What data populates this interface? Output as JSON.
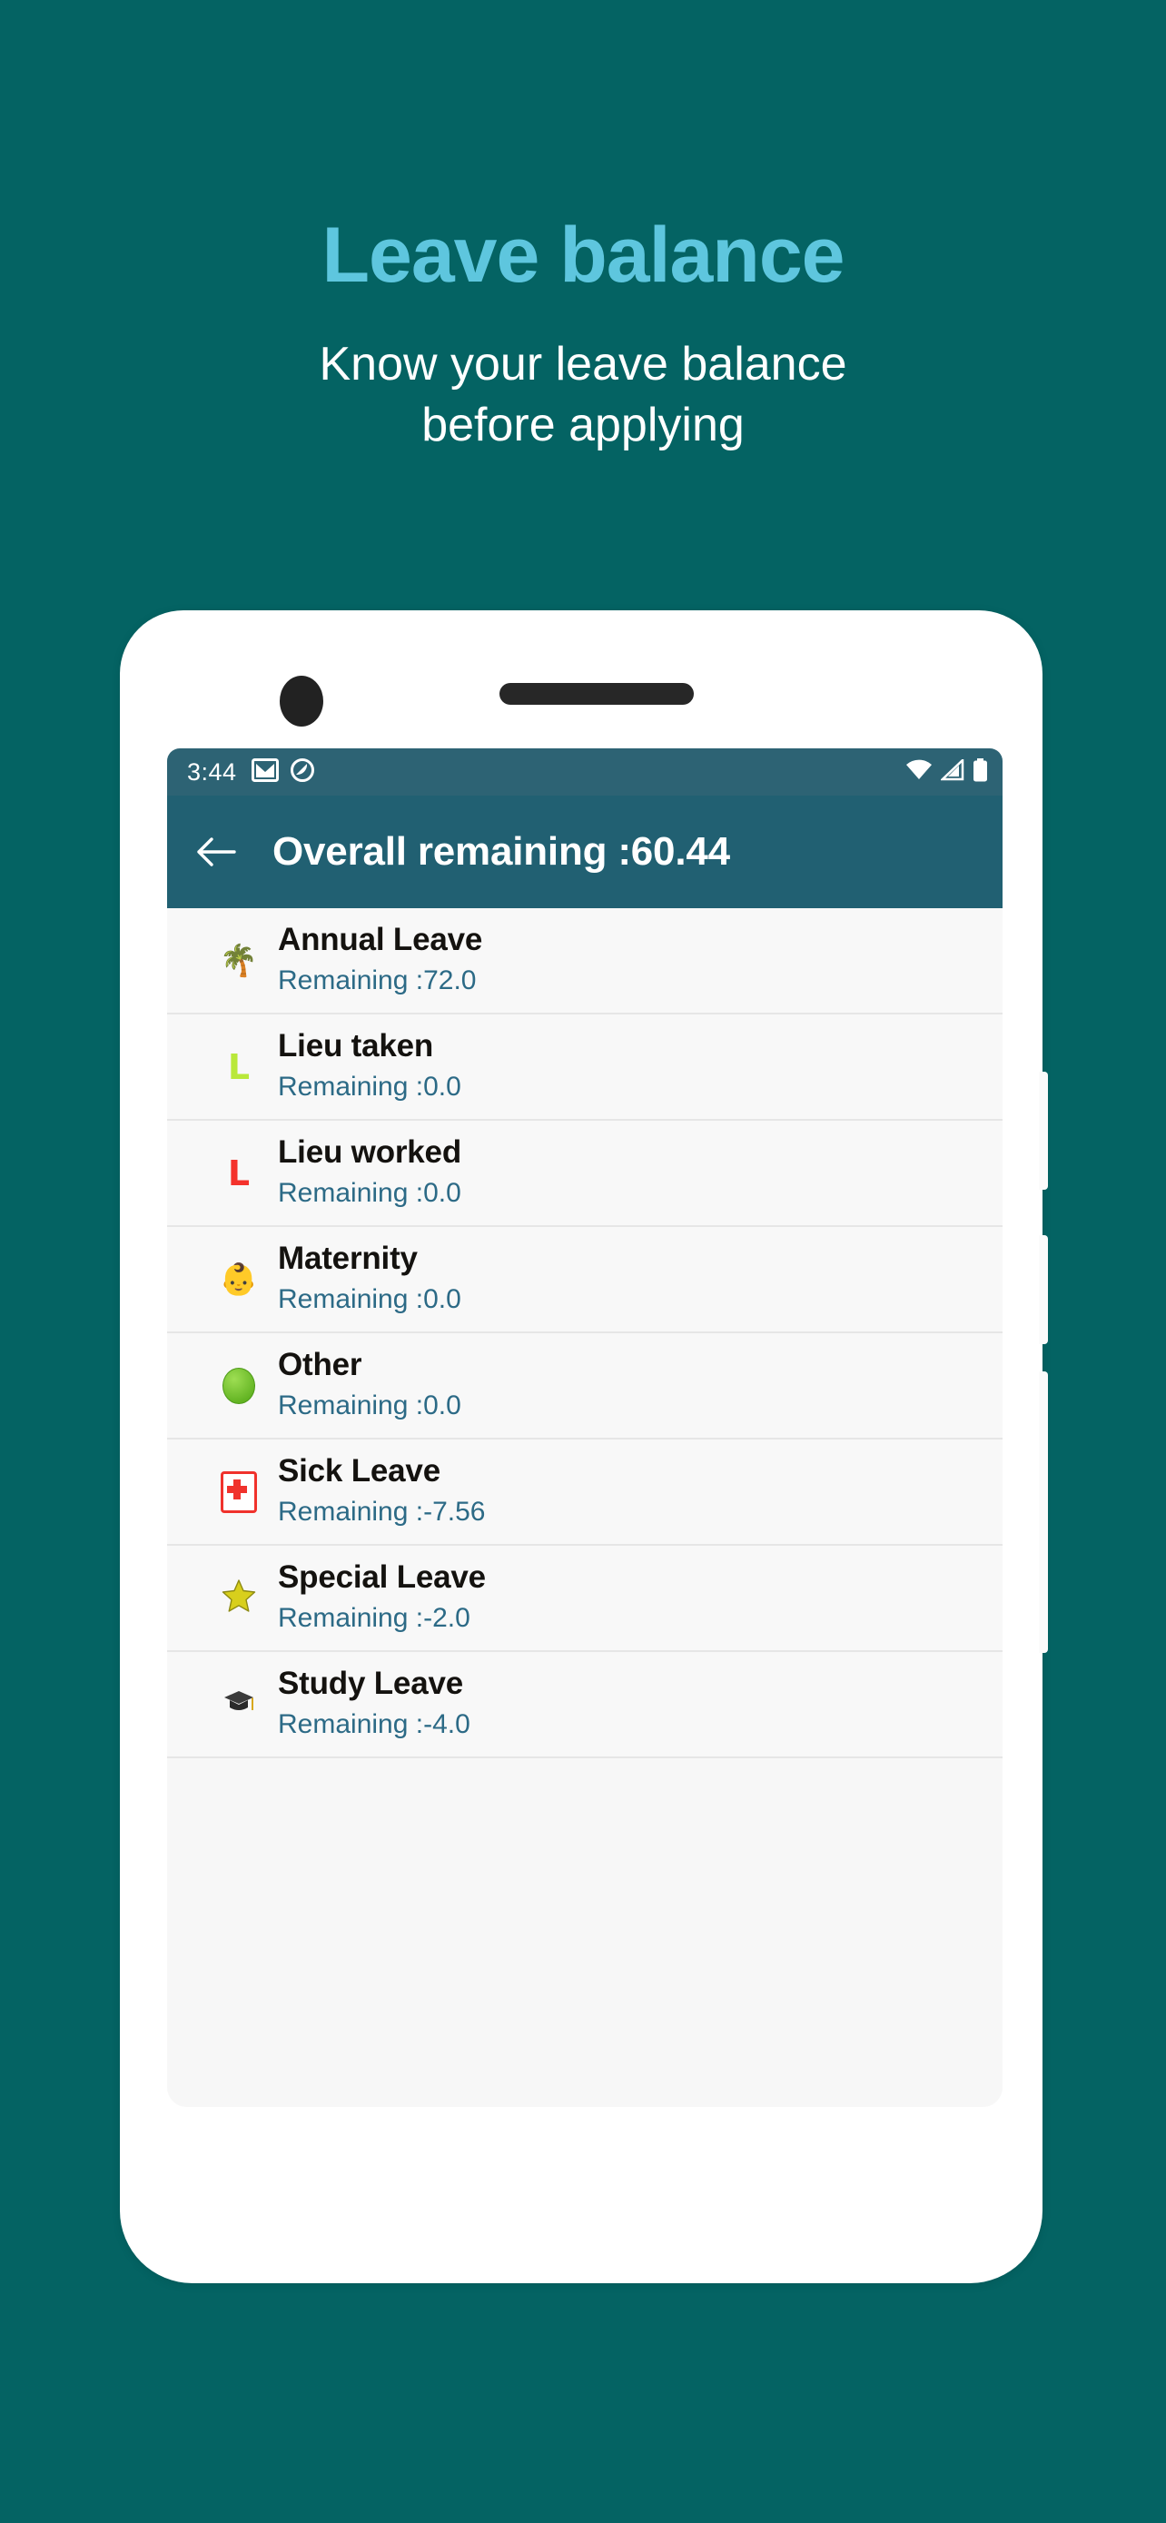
{
  "promo": {
    "title": "Leave balance",
    "subtitle_line1": "Know your leave balance",
    "subtitle_line2": "before applying",
    "title_color": "#5ec6de",
    "background_color": "#046363",
    "subtitle_color": "#ffffff"
  },
  "phone": {
    "statusbar": {
      "time": "3:44",
      "left_icons": [
        "gmail-icon",
        "do-not-disturb-icon"
      ],
      "right_icons": [
        "wifi-icon",
        "cellular-signal-icon",
        "battery-icon"
      ],
      "background_color": "#2d6374"
    },
    "appbar": {
      "back_label": "←",
      "title": "Overall remaining :60.44",
      "background_color": "#216072"
    },
    "list": [
      {
        "icon": "palm-tree-emoji",
        "glyph": "🌴",
        "title": "Annual Leave",
        "remaining": "Remaining :72.0"
      },
      {
        "icon": "letter-l-green-icon",
        "glyph": "L",
        "title": "Lieu taken",
        "remaining": "Remaining :0.0"
      },
      {
        "icon": "letter-l-red-icon",
        "glyph": "L",
        "title": "Lieu worked",
        "remaining": "Remaining :0.0"
      },
      {
        "icon": "baby-carriage-emoji",
        "glyph": "👶",
        "title": "Maternity",
        "remaining": "Remaining :0.0"
      },
      {
        "icon": "green-circle-icon",
        "glyph": "",
        "title": "Other",
        "remaining": "Remaining :0.0"
      },
      {
        "icon": "red-cross-icon",
        "glyph": "",
        "title": "Sick Leave",
        "remaining": "Remaining :-7.56"
      },
      {
        "icon": "star-emoji",
        "glyph": "⭐",
        "title": "Special Leave",
        "remaining": "Remaining :-2.0"
      },
      {
        "icon": "graduation-cap-emoji",
        "glyph": "🎓",
        "title": "Study Leave",
        "remaining": "Remaining :-4.0"
      }
    ]
  }
}
